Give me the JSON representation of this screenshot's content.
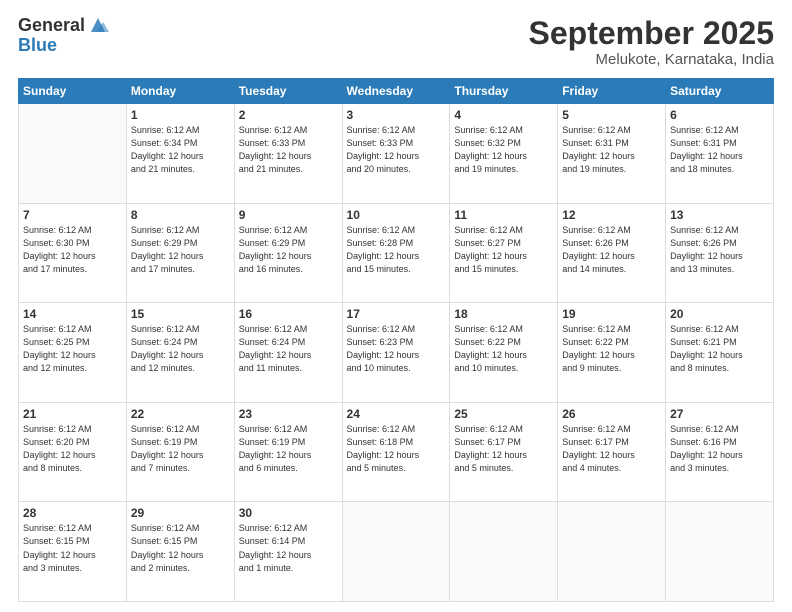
{
  "logo": {
    "general": "General",
    "blue": "Blue"
  },
  "title": "September 2025",
  "location": "Melukote, Karnataka, India",
  "days_header": [
    "Sunday",
    "Monday",
    "Tuesday",
    "Wednesday",
    "Thursday",
    "Friday",
    "Saturday"
  ],
  "weeks": [
    [
      {
        "day": "",
        "info": ""
      },
      {
        "day": "1",
        "info": "Sunrise: 6:12 AM\nSunset: 6:34 PM\nDaylight: 12 hours\nand 21 minutes."
      },
      {
        "day": "2",
        "info": "Sunrise: 6:12 AM\nSunset: 6:33 PM\nDaylight: 12 hours\nand 21 minutes."
      },
      {
        "day": "3",
        "info": "Sunrise: 6:12 AM\nSunset: 6:33 PM\nDaylight: 12 hours\nand 20 minutes."
      },
      {
        "day": "4",
        "info": "Sunrise: 6:12 AM\nSunset: 6:32 PM\nDaylight: 12 hours\nand 19 minutes."
      },
      {
        "day": "5",
        "info": "Sunrise: 6:12 AM\nSunset: 6:31 PM\nDaylight: 12 hours\nand 19 minutes."
      },
      {
        "day": "6",
        "info": "Sunrise: 6:12 AM\nSunset: 6:31 PM\nDaylight: 12 hours\nand 18 minutes."
      }
    ],
    [
      {
        "day": "7",
        "info": "Sunrise: 6:12 AM\nSunset: 6:30 PM\nDaylight: 12 hours\nand 17 minutes."
      },
      {
        "day": "8",
        "info": "Sunrise: 6:12 AM\nSunset: 6:29 PM\nDaylight: 12 hours\nand 17 minutes."
      },
      {
        "day": "9",
        "info": "Sunrise: 6:12 AM\nSunset: 6:29 PM\nDaylight: 12 hours\nand 16 minutes."
      },
      {
        "day": "10",
        "info": "Sunrise: 6:12 AM\nSunset: 6:28 PM\nDaylight: 12 hours\nand 15 minutes."
      },
      {
        "day": "11",
        "info": "Sunrise: 6:12 AM\nSunset: 6:27 PM\nDaylight: 12 hours\nand 15 minutes."
      },
      {
        "day": "12",
        "info": "Sunrise: 6:12 AM\nSunset: 6:26 PM\nDaylight: 12 hours\nand 14 minutes."
      },
      {
        "day": "13",
        "info": "Sunrise: 6:12 AM\nSunset: 6:26 PM\nDaylight: 12 hours\nand 13 minutes."
      }
    ],
    [
      {
        "day": "14",
        "info": "Sunrise: 6:12 AM\nSunset: 6:25 PM\nDaylight: 12 hours\nand 12 minutes."
      },
      {
        "day": "15",
        "info": "Sunrise: 6:12 AM\nSunset: 6:24 PM\nDaylight: 12 hours\nand 12 minutes."
      },
      {
        "day": "16",
        "info": "Sunrise: 6:12 AM\nSunset: 6:24 PM\nDaylight: 12 hours\nand 11 minutes."
      },
      {
        "day": "17",
        "info": "Sunrise: 6:12 AM\nSunset: 6:23 PM\nDaylight: 12 hours\nand 10 minutes."
      },
      {
        "day": "18",
        "info": "Sunrise: 6:12 AM\nSunset: 6:22 PM\nDaylight: 12 hours\nand 10 minutes."
      },
      {
        "day": "19",
        "info": "Sunrise: 6:12 AM\nSunset: 6:22 PM\nDaylight: 12 hours\nand 9 minutes."
      },
      {
        "day": "20",
        "info": "Sunrise: 6:12 AM\nSunset: 6:21 PM\nDaylight: 12 hours\nand 8 minutes."
      }
    ],
    [
      {
        "day": "21",
        "info": "Sunrise: 6:12 AM\nSunset: 6:20 PM\nDaylight: 12 hours\nand 8 minutes."
      },
      {
        "day": "22",
        "info": "Sunrise: 6:12 AM\nSunset: 6:19 PM\nDaylight: 12 hours\nand 7 minutes."
      },
      {
        "day": "23",
        "info": "Sunrise: 6:12 AM\nSunset: 6:19 PM\nDaylight: 12 hours\nand 6 minutes."
      },
      {
        "day": "24",
        "info": "Sunrise: 6:12 AM\nSunset: 6:18 PM\nDaylight: 12 hours\nand 5 minutes."
      },
      {
        "day": "25",
        "info": "Sunrise: 6:12 AM\nSunset: 6:17 PM\nDaylight: 12 hours\nand 5 minutes."
      },
      {
        "day": "26",
        "info": "Sunrise: 6:12 AM\nSunset: 6:17 PM\nDaylight: 12 hours\nand 4 minutes."
      },
      {
        "day": "27",
        "info": "Sunrise: 6:12 AM\nSunset: 6:16 PM\nDaylight: 12 hours\nand 3 minutes."
      }
    ],
    [
      {
        "day": "28",
        "info": "Sunrise: 6:12 AM\nSunset: 6:15 PM\nDaylight: 12 hours\nand 3 minutes."
      },
      {
        "day": "29",
        "info": "Sunrise: 6:12 AM\nSunset: 6:15 PM\nDaylight: 12 hours\nand 2 minutes."
      },
      {
        "day": "30",
        "info": "Sunrise: 6:12 AM\nSunset: 6:14 PM\nDaylight: 12 hours\nand 1 minute."
      },
      {
        "day": "",
        "info": ""
      },
      {
        "day": "",
        "info": ""
      },
      {
        "day": "",
        "info": ""
      },
      {
        "day": "",
        "info": ""
      }
    ]
  ]
}
